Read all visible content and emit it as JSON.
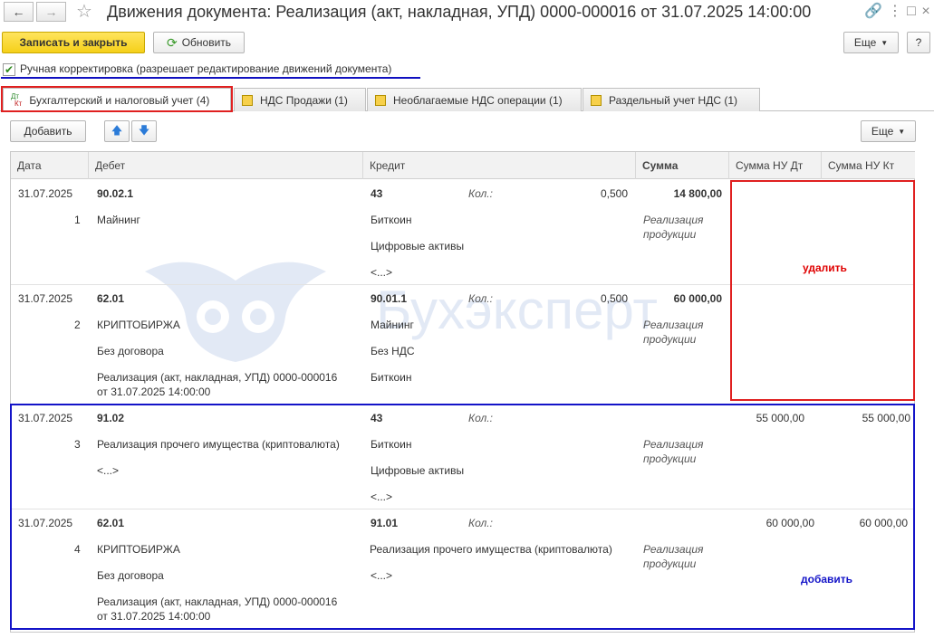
{
  "window": {
    "title": "Движения документа: Реализация (акт, накладная, УПД) 0000-000016 от 31.07.2025 14:00:00",
    "back_icon": "arrow-left-icon",
    "forward_icon": "arrow-right-icon",
    "favorite_icon": "star-icon",
    "link_icon": "link-icon",
    "menu_icon": "more-vertical-icon",
    "maximize_icon": "square-icon",
    "close_icon": "close-icon"
  },
  "toolbar": {
    "save_close": "Записать и закрыть",
    "refresh": "Обновить",
    "more": "Еще",
    "help": "?"
  },
  "manual_edit": {
    "checked": true,
    "label": "Ручная корректировка (разрешает редактирование движений документа)"
  },
  "tabs": [
    {
      "label": "Бухгалтерский и налоговый учет (4)",
      "icon_top": "Дт",
      "icon_bottom": "Кт",
      "active": true
    },
    {
      "label": "НДС Продажи (1)",
      "active": false
    },
    {
      "label": "Необлагаемые НДС операции (1)",
      "active": false
    },
    {
      "label": "Раздельный учет НДС (1)",
      "active": false
    }
  ],
  "table_toolbar": {
    "add": "Добавить",
    "move_up_icon": "arrow-up-icon",
    "move_down_icon": "arrow-down-icon",
    "more": "Еще"
  },
  "columns": {
    "date": "Дата",
    "debit": "Дебет",
    "credit": "Кредит",
    "sum": "Сумма",
    "nu_dt": "Сумма НУ Дт",
    "nu_kt": "Сумма НУ Кт"
  },
  "rows": [
    {
      "date": "31.07.2025",
      "num": "1",
      "debit_account": "90.02.1",
      "debit_lines": [
        "Майнинг"
      ],
      "credit_account": "43",
      "qty_label": "Кол.:",
      "qty": "0,500",
      "credit_lines": [
        "Биткоин",
        "Цифровые активы",
        "<...>"
      ],
      "sum": "14 800,00",
      "content": [
        "Реализация",
        "продукции"
      ],
      "nu_dt": "",
      "nu_kt": ""
    },
    {
      "date": "31.07.2025",
      "num": "2",
      "debit_account": "62.01",
      "debit_lines": [
        "КРИПТОБИРЖА",
        "Без договора",
        "Реализация (акт, накладная, УПД) 0000-000016",
        "от 31.07.2025 14:00:00"
      ],
      "credit_account": "90.01.1",
      "qty_label": "Кол.:",
      "qty": "0,500",
      "credit_lines": [
        "Майнинг",
        "Без НДС",
        "Биткоин"
      ],
      "sum": "60 000,00",
      "content": [
        "Реализация",
        "продукции"
      ],
      "nu_dt": "",
      "nu_kt": ""
    },
    {
      "date": "31.07.2025",
      "num": "3",
      "debit_account": "91.02",
      "debit_lines": [
        "Реализация прочего имущества (криптовалюта)",
        "<...>"
      ],
      "credit_account": "43",
      "qty_label": "Кол.:",
      "qty": "",
      "credit_lines": [
        "Биткоин",
        "Цифровые активы",
        "<...>"
      ],
      "sum": "",
      "content": [
        "Реализация",
        "продукции"
      ],
      "nu_dt": "55 000,00",
      "nu_kt": "55 000,00"
    },
    {
      "date": "31.07.2025",
      "num": "4",
      "debit_account": "62.01",
      "debit_lines": [
        "КРИПТОБИРЖА",
        "Без договора",
        "Реализация (акт, накладная, УПД) 0000-000016",
        "от 31.07.2025 14:00:00"
      ],
      "credit_account": "91.01",
      "qty_label": "Кол.:",
      "qty": "",
      "credit_lines": [
        "Реализация прочего имущества (криптовалюта)",
        "<...>"
      ],
      "sum": "",
      "content": [
        "Реализация",
        "продукции"
      ],
      "nu_dt": "60 000,00",
      "nu_kt": "60 000,00"
    }
  ],
  "annotations": {
    "delete": "удалить",
    "add": "добавить"
  },
  "watermark": "Бухэксперт",
  "colors": {
    "primary_button": "#f5d019",
    "annotation_red": "#e02020",
    "annotation_blue": "#1414c8"
  }
}
